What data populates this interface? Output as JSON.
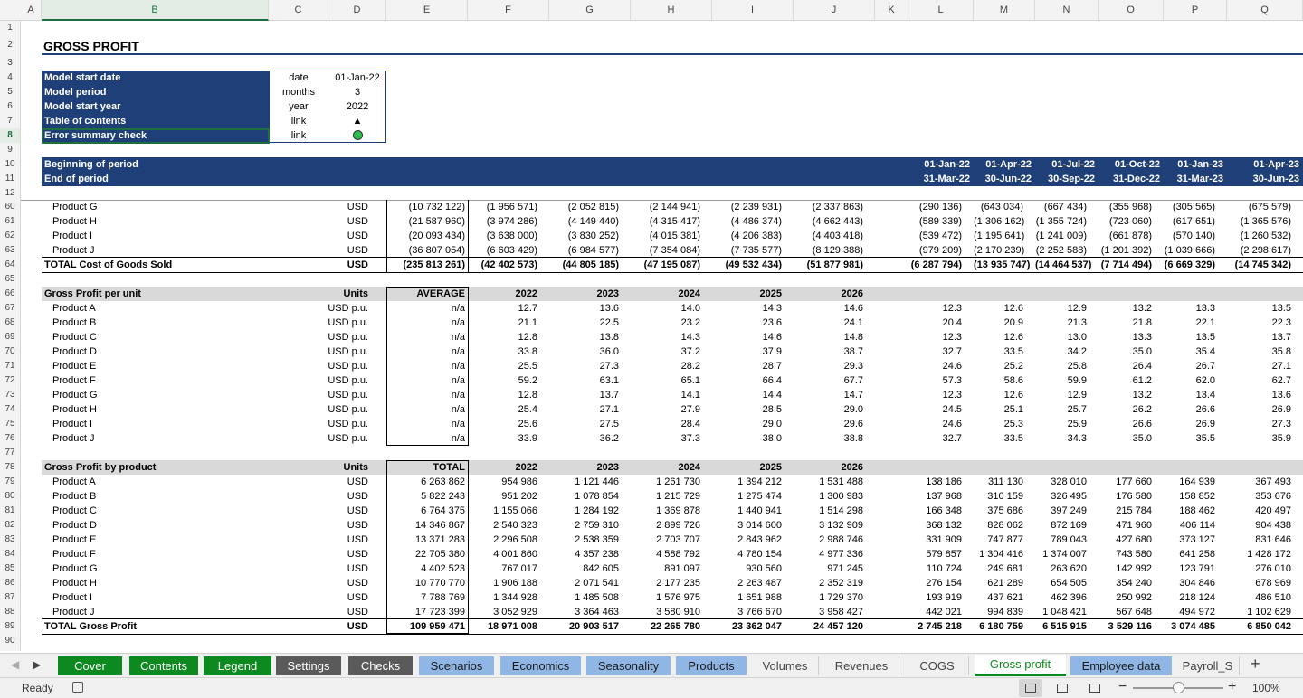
{
  "columns": [
    "A",
    "B",
    "C",
    "D",
    "E",
    "F",
    "G",
    "H",
    "I",
    "J",
    "K",
    "L",
    "M",
    "N",
    "O",
    "P",
    "Q"
  ],
  "selected_column": "B",
  "title": "GROSS PROFIT",
  "info": [
    [
      "Model start date",
      "date",
      "01-Jan-22"
    ],
    [
      "Model period",
      "months",
      "3"
    ],
    [
      "Model start year",
      "year",
      "2022"
    ],
    [
      "Table of contents",
      "link",
      "▲"
    ],
    [
      "Error summary check",
      "link",
      ""
    ]
  ],
  "period": {
    "begin_label": "Beginning of period",
    "end_label": "End of period",
    "begin": [
      "01-Jan-22",
      "01-Apr-22",
      "01-Jul-22",
      "01-Oct-22",
      "01-Jan-23",
      "01-Apr-23"
    ],
    "end": [
      "31-Mar-22",
      "30-Jun-22",
      "30-Sep-22",
      "31-Dec-22",
      "31-Mar-23",
      "30-Jun-23"
    ]
  },
  "cogs_rows": [
    {
      "row": "60",
      "label": "Product G",
      "unit": "USD",
      "e": "(10 732 122)",
      "vals": [
        "(1 956 571)",
        "(2 052 815)",
        "(2 144 941)",
        "(2 239 931)",
        "(2 337 863)",
        "(290 136)",
        "(643 034)",
        "(667 434)",
        "(355 968)",
        "(305 565)",
        "(675 579)"
      ]
    },
    {
      "row": "61",
      "label": "Product H",
      "unit": "USD",
      "e": "(21 587 960)",
      "vals": [
        "(3 974 286)",
        "(4 149 440)",
        "(4 315 417)",
        "(4 486 374)",
        "(4 662 443)",
        "(589 339)",
        "(1 306 162)",
        "(1 355 724)",
        "(723 060)",
        "(617 651)",
        "(1 365 576)"
      ]
    },
    {
      "row": "62",
      "label": "Product I",
      "unit": "USD",
      "e": "(20 093 434)",
      "vals": [
        "(3 638 000)",
        "(3 830 252)",
        "(4 015 381)",
        "(4 206 383)",
        "(4 403 418)",
        "(539 472)",
        "(1 195 641)",
        "(1 241 009)",
        "(661 878)",
        "(570 140)",
        "(1 260 532)"
      ]
    },
    {
      "row": "63",
      "label": "Product J",
      "unit": "USD",
      "e": "(36 807 054)",
      "vals": [
        "(6 603 429)",
        "(6 984 577)",
        "(7 354 084)",
        "(7 735 577)",
        "(8 129 388)",
        "(979 209)",
        "(2 170 239)",
        "(2 252 588)",
        "(1 201 392)",
        "(1 039 666)",
        "(2 298 617)"
      ]
    },
    {
      "row": "64",
      "label": "TOTAL Cost of Goods Sold",
      "unit": "USD",
      "e": "(235 813 261)",
      "bold": true,
      "vals": [
        "(42 402 573)",
        "(44 805 185)",
        "(47 195 087)",
        "(49 532 434)",
        "(51 877 981)",
        "(6 287 794)",
        "(13 935 747)",
        "(14 464 537)",
        "(7 714 494)",
        "(6 669 329)",
        "(14 745 342)"
      ]
    }
  ],
  "gp_unit": {
    "header": "Gross Profit per unit",
    "units": "Units",
    "agg": "AVERAGE",
    "years": [
      "2022",
      "2023",
      "2024",
      "2025",
      "2026"
    ],
    "rows": [
      {
        "row": "67",
        "label": "Product A",
        "unit": "USD p.u.",
        "e": "n/a",
        "vals": [
          "12.7",
          "13.6",
          "14.0",
          "14.3",
          "14.6",
          "12.3",
          "12.6",
          "12.9",
          "13.2",
          "13.3",
          "13.5"
        ]
      },
      {
        "row": "68",
        "label": "Product B",
        "unit": "USD p.u.",
        "e": "n/a",
        "vals": [
          "21.1",
          "22.5",
          "23.2",
          "23.6",
          "24.1",
          "20.4",
          "20.9",
          "21.3",
          "21.8",
          "22.1",
          "22.3"
        ]
      },
      {
        "row": "69",
        "label": "Product C",
        "unit": "USD p.u.",
        "e": "n/a",
        "vals": [
          "12.8",
          "13.8",
          "14.3",
          "14.6",
          "14.8",
          "12.3",
          "12.6",
          "13.0",
          "13.3",
          "13.5",
          "13.7"
        ]
      },
      {
        "row": "70",
        "label": "Product D",
        "unit": "USD p.u.",
        "e": "n/a",
        "vals": [
          "33.8",
          "36.0",
          "37.2",
          "37.9",
          "38.7",
          "32.7",
          "33.5",
          "34.2",
          "35.0",
          "35.4",
          "35.8"
        ]
      },
      {
        "row": "71",
        "label": "Product E",
        "unit": "USD p.u.",
        "e": "n/a",
        "vals": [
          "25.5",
          "27.3",
          "28.2",
          "28.7",
          "29.3",
          "24.6",
          "25.2",
          "25.8",
          "26.4",
          "26.7",
          "27.1"
        ]
      },
      {
        "row": "72",
        "label": "Product F",
        "unit": "USD p.u.",
        "e": "n/a",
        "vals": [
          "59.2",
          "63.1",
          "65.1",
          "66.4",
          "67.7",
          "57.3",
          "58.6",
          "59.9",
          "61.2",
          "62.0",
          "62.7"
        ]
      },
      {
        "row": "73",
        "label": "Product G",
        "unit": "USD p.u.",
        "e": "n/a",
        "vals": [
          "12.8",
          "13.7",
          "14.1",
          "14.4",
          "14.7",
          "12.3",
          "12.6",
          "12.9",
          "13.2",
          "13.4",
          "13.6"
        ]
      },
      {
        "row": "74",
        "label": "Product H",
        "unit": "USD p.u.",
        "e": "n/a",
        "vals": [
          "25.4",
          "27.1",
          "27.9",
          "28.5",
          "29.0",
          "24.5",
          "25.1",
          "25.7",
          "26.2",
          "26.6",
          "26.9"
        ]
      },
      {
        "row": "75",
        "label": "Product I",
        "unit": "USD p.u.",
        "e": "n/a",
        "vals": [
          "25.6",
          "27.5",
          "28.4",
          "29.0",
          "29.6",
          "24.6",
          "25.3",
          "25.9",
          "26.6",
          "26.9",
          "27.3"
        ]
      },
      {
        "row": "76",
        "label": "Product J",
        "unit": "USD p.u.",
        "e": "n/a",
        "vals": [
          "33.9",
          "36.2",
          "37.3",
          "38.0",
          "38.8",
          "32.7",
          "33.5",
          "34.3",
          "35.0",
          "35.5",
          "35.9"
        ]
      }
    ]
  },
  "gp_prod": {
    "header": "Gross Profit by product",
    "units": "Units",
    "agg": "TOTAL",
    "years": [
      "2022",
      "2023",
      "2024",
      "2025",
      "2026"
    ],
    "rows": [
      {
        "row": "79",
        "label": "Product A",
        "unit": "USD",
        "e": "6 263 862",
        "vals": [
          "954 986",
          "1 121 446",
          "1 261 730",
          "1 394 212",
          "1 531 488",
          "138 186",
          "311 130",
          "328 010",
          "177 660",
          "164 939",
          "367 493"
        ]
      },
      {
        "row": "80",
        "label": "Product B",
        "unit": "USD",
        "e": "5 822 243",
        "vals": [
          "951 202",
          "1 078 854",
          "1 215 729",
          "1 275 474",
          "1 300 983",
          "137 968",
          "310 159",
          "326 495",
          "176 580",
          "158 852",
          "353 676"
        ]
      },
      {
        "row": "81",
        "label": "Product C",
        "unit": "USD",
        "e": "6 764 375",
        "vals": [
          "1 155 066",
          "1 284 192",
          "1 369 878",
          "1 440 941",
          "1 514 298",
          "166 348",
          "375 686",
          "397 249",
          "215 784",
          "188 462",
          "420 497"
        ]
      },
      {
        "row": "82",
        "label": "Product D",
        "unit": "USD",
        "e": "14 346 867",
        "vals": [
          "2 540 323",
          "2 759 310",
          "2 899 726",
          "3 014 600",
          "3 132 909",
          "368 132",
          "828 062",
          "872 169",
          "471 960",
          "406 114",
          "904 438"
        ]
      },
      {
        "row": "83",
        "label": "Product E",
        "unit": "USD",
        "e": "13 371 283",
        "vals": [
          "2 296 508",
          "2 538 359",
          "2 703 707",
          "2 843 962",
          "2 988 746",
          "331 909",
          "747 877",
          "789 043",
          "427 680",
          "373 127",
          "831 646"
        ]
      },
      {
        "row": "84",
        "label": "Product F",
        "unit": "USD",
        "e": "22 705 380",
        "vals": [
          "4 001 860",
          "4 357 238",
          "4 588 792",
          "4 780 154",
          "4 977 336",
          "579 857",
          "1 304 416",
          "1 374 007",
          "743 580",
          "641 258",
          "1 428 172"
        ]
      },
      {
        "row": "85",
        "label": "Product G",
        "unit": "USD",
        "e": "4 402 523",
        "vals": [
          "767 017",
          "842 605",
          "891 097",
          "930 560",
          "971 245",
          "110 724",
          "249 681",
          "263 620",
          "142 992",
          "123 791",
          "276 010"
        ]
      },
      {
        "row": "86",
        "label": "Product H",
        "unit": "USD",
        "e": "10 770 770",
        "vals": [
          "1 906 188",
          "2 071 541",
          "2 177 235",
          "2 263 487",
          "2 352 319",
          "276 154",
          "621 289",
          "654 505",
          "354 240",
          "304 846",
          "678 969"
        ]
      },
      {
        "row": "87",
        "label": "Product I",
        "unit": "USD",
        "e": "7 788 769",
        "vals": [
          "1 344 928",
          "1 485 508",
          "1 576 975",
          "1 651 988",
          "1 729 370",
          "193 919",
          "437 621",
          "462 396",
          "250 992",
          "218 124",
          "486 510"
        ]
      },
      {
        "row": "88",
        "label": "Product J",
        "unit": "USD",
        "e": "17 723 399",
        "vals": [
          "3 052 929",
          "3 364 463",
          "3 580 910",
          "3 766 670",
          "3 958 427",
          "442 021",
          "994 839",
          "1 048 421",
          "567 648",
          "494 972",
          "1 102 629"
        ]
      },
      {
        "row": "89",
        "label": "TOTAL Gross Profit",
        "unit": "USD",
        "e": "109 959 471",
        "bold": true,
        "vals": [
          "18 971 008",
          "20 903 517",
          "22 265 780",
          "23 362 047",
          "24 457 120",
          "2 745 218",
          "6 180 759",
          "6 515 915",
          "3 529 116",
          "3 074 485",
          "6 850 042"
        ]
      }
    ]
  },
  "tabs": [
    {
      "label": "Cover",
      "style": "green"
    },
    {
      "label": "Contents",
      "style": "green"
    },
    {
      "label": "Legend",
      "style": "green"
    },
    {
      "label": "Settings",
      "style": "dark"
    },
    {
      "label": "Checks",
      "style": "dark"
    },
    {
      "label": "Scenarios",
      "style": "lblue"
    },
    {
      "label": "Economics",
      "style": "lblue"
    },
    {
      "label": "Seasonality",
      "style": "lblue"
    },
    {
      "label": "Products",
      "style": "lblue"
    },
    {
      "label": "Volumes",
      "style": "plain"
    },
    {
      "label": "Revenues",
      "style": "plain"
    },
    {
      "label": "COGS",
      "style": "plain"
    },
    {
      "label": "Gross profit",
      "style": "active"
    },
    {
      "label": "Employee data",
      "style": "lblue"
    },
    {
      "label": "Payroll_S",
      "style": "plain"
    }
  ],
  "status": {
    "ready": "Ready",
    "zoom": "100%"
  },
  "colors": {
    "header_blue": "#1f3f78",
    "check_green": "#2ebd4f",
    "tab_green": "#0c8a1f"
  }
}
